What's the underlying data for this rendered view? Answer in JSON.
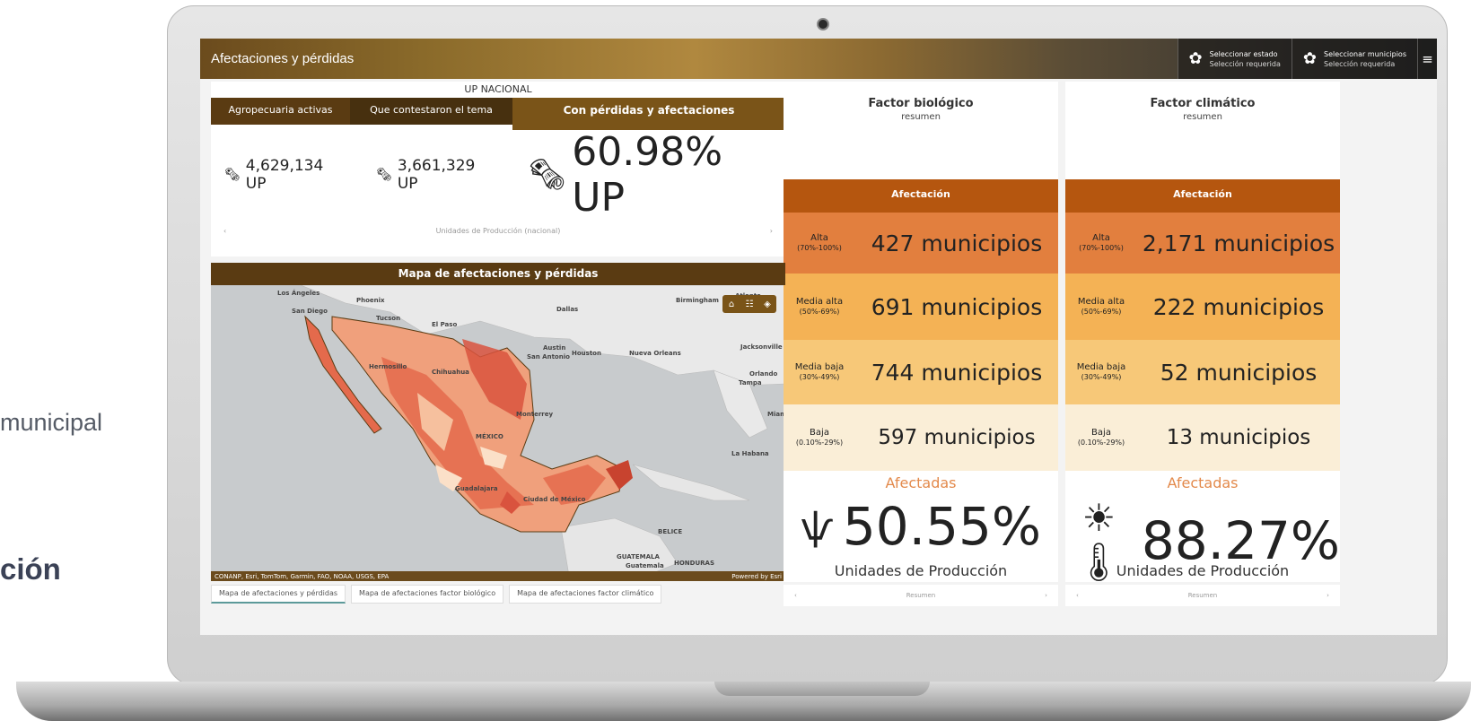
{
  "side": {
    "municipal": "municipal",
    "cion": "ción"
  },
  "dashboard": {
    "title": "Afectaciones y pérdidas",
    "buttons": [
      {
        "title": "Seleccionar estado",
        "sub": "Selección requerida",
        "icon": "gear-icon"
      },
      {
        "title": "Seleccionar municipios",
        "sub": "Selección requerida",
        "icon": "gear-icon"
      }
    ],
    "menu_icon": "≡"
  },
  "up": {
    "title": "UP NACIONAL",
    "tabs": [
      "Agropecuaria activas",
      "Que contestaron el tema",
      "Con pérdidas y afectaciones"
    ],
    "stats": [
      "4,629,134 UP",
      "3,661,329 UP",
      "60.98% UP"
    ],
    "nav_label": "Unidades de Producción (nacional)",
    "prev": "‹",
    "next": "›"
  },
  "map": {
    "title": "Mapa de afectaciones y pérdidas",
    "attribution": "CONANP, Esri, TomTom, Garmin, FAO, NOAA, USGS, EPA",
    "powered": "Powered by Esri",
    "cities": [
      "Los Ángeles",
      "Phoenix",
      "San Diego",
      "Tucson",
      "El Paso",
      "Dallas",
      "Birmingham",
      "Atlanta",
      "Austin",
      "San Antonio",
      "Houston",
      "Nueva Orleans",
      "Jacksonville",
      "Orlando",
      "Tampa",
      "Miami",
      "Hermosillo",
      "Chihuahua",
      "Monterrey",
      "MÉXICO",
      "Guadalajara",
      "Ciudad de México",
      "La Habana",
      "BELICE",
      "GUATEMALA",
      "Guatemala",
      "HONDURAS"
    ],
    "tools": [
      "⌂",
      "☷",
      "◈"
    ]
  },
  "bottom_tabs": [
    "Mapa de afectaciones y pérdidas",
    "Mapa de afectaciones factor biológico",
    "Mapa de afectaciones factor climático"
  ],
  "factors": [
    {
      "title": "Factor biológico",
      "sub": "resumen",
      "head": "Afectación",
      "rows": [
        {
          "label": "Alta",
          "range": "(70%-100%)",
          "value": "427 municipios"
        },
        {
          "label": "Media alta",
          "range": "(50%-69%)",
          "value": "691 municipios"
        },
        {
          "label": "Media baja",
          "range": "(30%-49%)",
          "value": "744 municipios"
        },
        {
          "label": "Baja",
          "range": "(0.10%-29%)",
          "value": "597 municipios"
        }
      ],
      "afectadas": "Afectadas",
      "pct": "50.55%",
      "icon": "coral-icon",
      "unit": "Unidades de Producción",
      "nav": "Resumen"
    },
    {
      "title": "Factor climático",
      "sub": "resumen",
      "head": "Afectación",
      "rows": [
        {
          "label": "Alta",
          "range": "(70%-100%)",
          "value": "2,171 municipios"
        },
        {
          "label": "Media alta",
          "range": "(50%-69%)",
          "value": "222 municipios"
        },
        {
          "label": "Media baja",
          "range": "(30%-49%)",
          "value": "52 municipios"
        },
        {
          "label": "Baja",
          "range": "(0.10%-29%)",
          "value": "13 municipios"
        }
      ],
      "afectadas": "Afectadas",
      "pct": "88.27%",
      "icon": "thermometer-sun-icon",
      "unit": "Unidades de Producción",
      "nav": "Resumen"
    }
  ]
}
